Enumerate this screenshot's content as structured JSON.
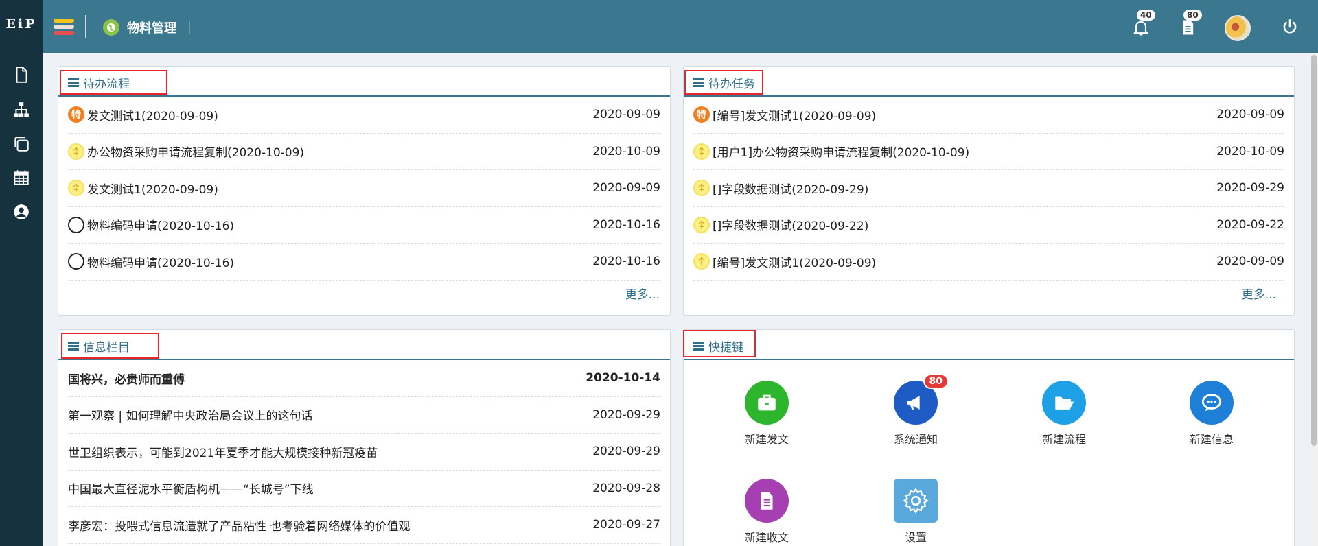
{
  "sidebar": {
    "logo": "EiP",
    "icons": [
      "file-icon",
      "org-chart-icon",
      "copy-icon",
      "calendar-icon",
      "user-icon"
    ]
  },
  "topbar": {
    "module_title": "物料管理",
    "notifications_count": "40",
    "messages_count": "80"
  },
  "pending_flows": {
    "title": "待办流程",
    "items": [
      {
        "status": "special",
        "status_char": "特",
        "text": "发文测试1(2020-09-09)",
        "date": "2020-09-09"
      },
      {
        "status": "urgent",
        "status_char": "",
        "text": "办公物资采购申请流程复制(2020-10-09)",
        "date": "2020-10-09"
      },
      {
        "status": "urgent",
        "status_char": "",
        "text": "发文测试1(2020-09-09)",
        "date": "2020-09-09"
      },
      {
        "status": "normal",
        "status_char": "",
        "text": "物料编码申请(2020-10-16)",
        "date": "2020-10-16"
      },
      {
        "status": "normal",
        "status_char": "",
        "text": "物料编码申请(2020-10-16)",
        "date": "2020-10-16"
      }
    ],
    "more": "更多..."
  },
  "pending_tasks": {
    "title": "待办任务",
    "items": [
      {
        "status": "special",
        "status_char": "特",
        "text": "[编号]发文测试1(2020-09-09)",
        "date": "2020-09-09"
      },
      {
        "status": "urgent",
        "status_char": "",
        "text": "[用户1]办公物资采购申请流程复制(2020-10-09)",
        "date": "2020-10-09"
      },
      {
        "status": "urgent",
        "status_char": "",
        "text": "[]字段数据测试(2020-09-29)",
        "date": "2020-09-29"
      },
      {
        "status": "urgent",
        "status_char": "",
        "text": "[]字段数据测试(2020-09-22)",
        "date": "2020-09-22"
      },
      {
        "status": "urgent",
        "status_char": "",
        "text": "[编号]发文测试1(2020-09-09)",
        "date": "2020-09-09"
      }
    ],
    "more": "更多..."
  },
  "info_column": {
    "title": "信息栏目",
    "items": [
      {
        "text": "国将兴，必贵师而重傅",
        "date": "2020-10-14",
        "bold": true
      },
      {
        "text": "第一观察 | 如何理解中央政治局会议上的这句话",
        "date": "2020-09-29",
        "bold": false
      },
      {
        "text": "世卫组织表示，可能到2021年夏季才能大规模接种新冠疫苗",
        "date": "2020-09-29",
        "bold": false
      },
      {
        "text": "中国最大直径泥水平衡盾构机——“长城号”下线",
        "date": "2020-09-28",
        "bold": false
      },
      {
        "text": "李彦宏：投喂式信息流造就了产品粘性 也考验着网络媒体的价值观",
        "date": "2020-09-27",
        "bold": false
      }
    ]
  },
  "shortcuts": {
    "title": "快捷键",
    "items": [
      {
        "label": "新建发文",
        "icon": "briefcase-icon",
        "color": "#2db52d"
      },
      {
        "label": "系统通知",
        "icon": "megaphone-icon",
        "color": "#1f5bc4",
        "badge": "80"
      },
      {
        "label": "新建流程",
        "icon": "folder-open-icon",
        "color": "#1ea0e6"
      },
      {
        "label": "新建信息",
        "icon": "chat-bubbles-icon",
        "color": "#1e7fd6"
      },
      {
        "label": "新建收文",
        "icon": "document-icon",
        "color": "#a53fb2"
      },
      {
        "label": "设置",
        "icon": "gear-icon",
        "color": "#5aa9dc"
      }
    ]
  }
}
